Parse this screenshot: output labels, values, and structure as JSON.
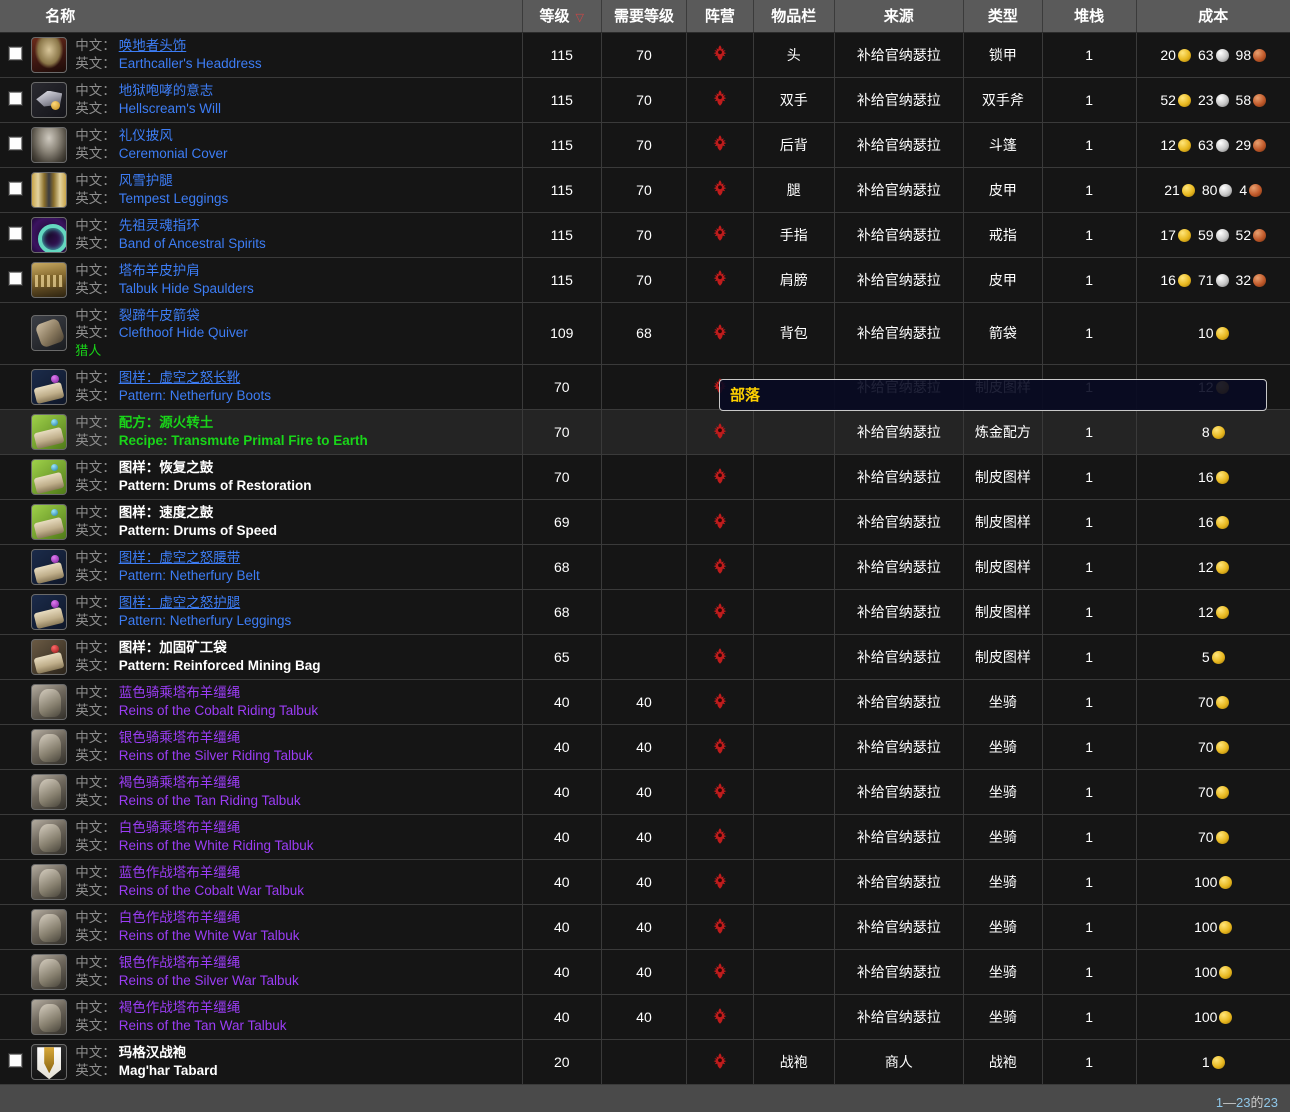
{
  "header": {
    "columns": [
      {
        "label": "",
        "key": "check"
      },
      {
        "label": "名称",
        "key": "name"
      },
      {
        "label": "等级",
        "key": "level",
        "sorted": true,
        "sort_arrow": "▽"
      },
      {
        "label": "需要等级",
        "key": "reqlevel"
      },
      {
        "label": "阵营",
        "key": "faction"
      },
      {
        "label": "物品栏",
        "key": "slot"
      },
      {
        "label": "来源",
        "key": "source"
      },
      {
        "label": "类型",
        "key": "type"
      },
      {
        "label": "堆栈",
        "key": "stack"
      },
      {
        "label": "成本",
        "key": "cost"
      }
    ]
  },
  "labels": {
    "cn": "中文：",
    "en": "英文："
  },
  "colors": {
    "quality_rare": "#3d7df5",
    "quality_epic": "#9b3df5",
    "quality_uncommon": "#19d519",
    "quality_common": "#ffffff",
    "gold": "#e8b820",
    "silver": "#c7c7c7",
    "copper": "#c0592a",
    "faction_horde": "#c01c1c",
    "header_bg": "#5a5a5a",
    "row_bg": "#151515",
    "row_hover_bg": "#242424"
  },
  "tooltip": {
    "visible": true,
    "text": "部落"
  },
  "footer": {
    "range_prefix": "1",
    "dash": "—",
    "range_end": "23",
    "of": "的",
    "total": "23",
    "text": "1—23的23"
  },
  "rows": [
    {
      "checkbox": true,
      "icon": "item-icon-headdress",
      "icon_class": "ic-head",
      "cn": "唤地者头饰",
      "en": "Earthcaller's Headdress",
      "quality": "rare",
      "underline": true,
      "level": "115",
      "reqlevel": "70",
      "faction": "horde",
      "slot": "头",
      "source": "补给官纳瑟拉",
      "type": "锁甲",
      "stack": "1",
      "cost": [
        {
          "amt": "20",
          "coin": "gold"
        },
        {
          "amt": "63",
          "coin": "silver"
        },
        {
          "amt": "98",
          "coin": "copper"
        }
      ]
    },
    {
      "checkbox": true,
      "icon": "item-icon-axe",
      "icon_class": "ic-axe",
      "cn": "地狱咆哮的意志",
      "en": "Hellscream's Will",
      "quality": "rare",
      "underline": false,
      "level": "115",
      "reqlevel": "70",
      "faction": "horde",
      "slot": "双手",
      "source": "补给官纳瑟拉",
      "type": "双手斧",
      "stack": "1",
      "cost": [
        {
          "amt": "52",
          "coin": "gold"
        },
        {
          "amt": "23",
          "coin": "silver"
        },
        {
          "amt": "58",
          "coin": "copper"
        }
      ]
    },
    {
      "checkbox": true,
      "icon": "item-icon-cloak",
      "icon_class": "ic-cloak",
      "cn": "礼仪披风",
      "en": "Ceremonial Cover",
      "quality": "rare",
      "underline": false,
      "level": "115",
      "reqlevel": "70",
      "faction": "horde",
      "slot": "后背",
      "source": "补给官纳瑟拉",
      "type": "斗篷",
      "stack": "1",
      "cost": [
        {
          "amt": "12",
          "coin": "gold"
        },
        {
          "amt": "63",
          "coin": "silver"
        },
        {
          "amt": "29",
          "coin": "copper"
        }
      ]
    },
    {
      "checkbox": true,
      "icon": "item-icon-leggings",
      "icon_class": "ic-legs",
      "cn": "风雪护腿",
      "en": "Tempest Leggings",
      "quality": "rare",
      "underline": false,
      "level": "115",
      "reqlevel": "70",
      "faction": "horde",
      "slot": "腿",
      "source": "补给官纳瑟拉",
      "type": "皮甲",
      "stack": "1",
      "cost": [
        {
          "amt": "21",
          "coin": "gold"
        },
        {
          "amt": "80",
          "coin": "silver"
        },
        {
          "amt": "4",
          "coin": "copper"
        }
      ]
    },
    {
      "checkbox": true,
      "icon": "item-icon-ring",
      "icon_class": "ic-ring",
      "cn": "先祖灵魂指环",
      "en": "Band of Ancestral Spirits",
      "quality": "rare",
      "underline": false,
      "level": "115",
      "reqlevel": "70",
      "faction": "horde",
      "slot": "手指",
      "source": "补给官纳瑟拉",
      "type": "戒指",
      "stack": "1",
      "cost": [
        {
          "amt": "17",
          "coin": "gold"
        },
        {
          "amt": "59",
          "coin": "silver"
        },
        {
          "amt": "52",
          "coin": "copper"
        }
      ]
    },
    {
      "checkbox": true,
      "icon": "item-icon-spaulders",
      "icon_class": "ic-shoulder",
      "cn": "塔布羊皮护肩",
      "en": "Talbuk Hide Spaulders",
      "quality": "rare",
      "underline": false,
      "level": "115",
      "reqlevel": "70",
      "faction": "horde",
      "slot": "肩膀",
      "source": "补给官纳瑟拉",
      "type": "皮甲",
      "stack": "1",
      "cost": [
        {
          "amt": "16",
          "coin": "gold"
        },
        {
          "amt": "71",
          "coin": "silver"
        },
        {
          "amt": "32",
          "coin": "copper"
        }
      ]
    },
    {
      "checkbox": false,
      "icon": "item-icon-quiver",
      "icon_class": "ic-quiver",
      "cn": "裂蹄牛皮箭袋",
      "en": "Clefthoof Hide Quiver",
      "quality": "rare",
      "underline": false,
      "level": "109",
      "reqlevel": "68",
      "faction": "horde",
      "slot": "背包",
      "source": "补给官纳瑟拉",
      "type": "箭袋",
      "stack": "1",
      "cost": [
        {
          "amt": "10",
          "coin": "gold"
        }
      ],
      "subclass": "猎人"
    },
    {
      "checkbox": false,
      "icon": "item-icon-pattern-blue",
      "icon_class": "ic-pat-b",
      "cn": "图样：虚空之怒长靴",
      "en": "Pattern: Netherfury Boots",
      "quality": "rare",
      "underline": true,
      "level": "70",
      "reqlevel": "",
      "faction": "horde",
      "slot": "",
      "source": "补给官纳瑟拉",
      "type": "制皮图样",
      "stack": "1",
      "cost": [
        {
          "amt": "12",
          "coin": "gold"
        }
      ]
    },
    {
      "checkbox": false,
      "icon": "item-icon-recipe-green",
      "icon_class": "ic-pat-g",
      "cn": "配方：源火转土",
      "en": "Recipe: Transmute Primal Fire to Earth",
      "quality": "uncommon",
      "underline": false,
      "level": "70",
      "reqlevel": "",
      "faction": "horde",
      "slot": "",
      "source": "补给官纳瑟拉",
      "type": "炼金配方",
      "stack": "1",
      "cost": [
        {
          "amt": "8",
          "coin": "gold"
        }
      ],
      "hover": true
    },
    {
      "checkbox": false,
      "icon": "item-icon-pattern-white",
      "icon_class": "ic-pat-g",
      "cn": "图样：恢复之鼓",
      "en": "Pattern: Drums of Restoration",
      "quality": "common",
      "underline": false,
      "level": "70",
      "reqlevel": "",
      "faction": "horde",
      "slot": "",
      "source": "补给官纳瑟拉",
      "type": "制皮图样",
      "stack": "1",
      "cost": [
        {
          "amt": "16",
          "coin": "gold"
        }
      ]
    },
    {
      "checkbox": false,
      "icon": "item-icon-pattern-white",
      "icon_class": "ic-pat-g",
      "cn": "图样：速度之鼓",
      "en": "Pattern: Drums of Speed",
      "quality": "common",
      "underline": false,
      "level": "69",
      "reqlevel": "",
      "faction": "horde",
      "slot": "",
      "source": "补给官纳瑟拉",
      "type": "制皮图样",
      "stack": "1",
      "cost": [
        {
          "amt": "16",
          "coin": "gold"
        }
      ]
    },
    {
      "checkbox": false,
      "icon": "item-icon-pattern-blue",
      "icon_class": "ic-pat-b",
      "cn": "图样：虚空之怒腰带",
      "en": "Pattern: Netherfury Belt",
      "quality": "rare",
      "underline": true,
      "level": "68",
      "reqlevel": "",
      "faction": "horde",
      "slot": "",
      "source": "补给官纳瑟拉",
      "type": "制皮图样",
      "stack": "1",
      "cost": [
        {
          "amt": "12",
          "coin": "gold"
        }
      ]
    },
    {
      "checkbox": false,
      "icon": "item-icon-pattern-blue",
      "icon_class": "ic-pat-b",
      "cn": "图样：虚空之怒护腿",
      "en": "Pattern: Netherfury Leggings",
      "quality": "rare",
      "underline": true,
      "level": "68",
      "reqlevel": "",
      "faction": "horde",
      "slot": "",
      "source": "补给官纳瑟拉",
      "type": "制皮图样",
      "stack": "1",
      "cost": [
        {
          "amt": "12",
          "coin": "gold"
        }
      ]
    },
    {
      "checkbox": false,
      "icon": "item-icon-pattern-red",
      "icon_class": "ic-pat-r",
      "cn": "图样：加固矿工袋",
      "en": "Pattern: Reinforced Mining Bag",
      "quality": "common",
      "underline": false,
      "level": "65",
      "reqlevel": "",
      "faction": "horde",
      "slot": "",
      "source": "补给官纳瑟拉",
      "type": "制皮图样",
      "stack": "1",
      "cost": [
        {
          "amt": "5",
          "coin": "gold"
        }
      ]
    },
    {
      "checkbox": false,
      "icon": "item-icon-talbuk",
      "icon_class": "ic-mount",
      "cn": "蓝色骑乘塔布羊缰绳",
      "en": "Reins of the Cobalt Riding Talbuk",
      "quality": "epic",
      "underline": false,
      "level": "40",
      "reqlevel": "40",
      "faction": "horde",
      "slot": "",
      "source": "补给官纳瑟拉",
      "type": "坐骑",
      "stack": "1",
      "cost": [
        {
          "amt": "70",
          "coin": "gold"
        }
      ]
    },
    {
      "checkbox": false,
      "icon": "item-icon-talbuk",
      "icon_class": "ic-mount",
      "cn": "银色骑乘塔布羊缰绳",
      "en": "Reins of the Silver Riding Talbuk",
      "quality": "epic",
      "underline": false,
      "level": "40",
      "reqlevel": "40",
      "faction": "horde",
      "slot": "",
      "source": "补给官纳瑟拉",
      "type": "坐骑",
      "stack": "1",
      "cost": [
        {
          "amt": "70",
          "coin": "gold"
        }
      ]
    },
    {
      "checkbox": false,
      "icon": "item-icon-talbuk",
      "icon_class": "ic-mount",
      "cn": "褐色骑乘塔布羊缰绳",
      "en": "Reins of the Tan Riding Talbuk",
      "quality": "epic",
      "underline": false,
      "level": "40",
      "reqlevel": "40",
      "faction": "horde",
      "slot": "",
      "source": "补给官纳瑟拉",
      "type": "坐骑",
      "stack": "1",
      "cost": [
        {
          "amt": "70",
          "coin": "gold"
        }
      ]
    },
    {
      "checkbox": false,
      "icon": "item-icon-talbuk",
      "icon_class": "ic-mount",
      "cn": "白色骑乘塔布羊缰绳",
      "en": "Reins of the White Riding Talbuk",
      "quality": "epic",
      "underline": false,
      "level": "40",
      "reqlevel": "40",
      "faction": "horde",
      "slot": "",
      "source": "补给官纳瑟拉",
      "type": "坐骑",
      "stack": "1",
      "cost": [
        {
          "amt": "70",
          "coin": "gold"
        }
      ]
    },
    {
      "checkbox": false,
      "icon": "item-icon-talbuk",
      "icon_class": "ic-mount",
      "cn": "蓝色作战塔布羊缰绳",
      "en": "Reins of the Cobalt War Talbuk",
      "quality": "epic",
      "underline": false,
      "level": "40",
      "reqlevel": "40",
      "faction": "horde",
      "slot": "",
      "source": "补给官纳瑟拉",
      "type": "坐骑",
      "stack": "1",
      "cost": [
        {
          "amt": "100",
          "coin": "gold"
        }
      ]
    },
    {
      "checkbox": false,
      "icon": "item-icon-talbuk",
      "icon_class": "ic-mount",
      "cn": "白色作战塔布羊缰绳",
      "en": "Reins of the White War Talbuk",
      "quality": "epic",
      "underline": false,
      "level": "40",
      "reqlevel": "40",
      "faction": "horde",
      "slot": "",
      "source": "补给官纳瑟拉",
      "type": "坐骑",
      "stack": "1",
      "cost": [
        {
          "amt": "100",
          "coin": "gold"
        }
      ]
    },
    {
      "checkbox": false,
      "icon": "item-icon-talbuk",
      "icon_class": "ic-mount",
      "cn": "银色作战塔布羊缰绳",
      "en": "Reins of the Silver War Talbuk",
      "quality": "epic",
      "underline": false,
      "level": "40",
      "reqlevel": "40",
      "faction": "horde",
      "slot": "",
      "source": "补给官纳瑟拉",
      "type": "坐骑",
      "stack": "1",
      "cost": [
        {
          "amt": "100",
          "coin": "gold"
        }
      ]
    },
    {
      "checkbox": false,
      "icon": "item-icon-talbuk",
      "icon_class": "ic-mount",
      "cn": "褐色作战塔布羊缰绳",
      "en": "Reins of the Tan War Talbuk",
      "quality": "epic",
      "underline": false,
      "level": "40",
      "reqlevel": "40",
      "faction": "horde",
      "slot": "",
      "source": "补给官纳瑟拉",
      "type": "坐骑",
      "stack": "1",
      "cost": [
        {
          "amt": "100",
          "coin": "gold"
        }
      ]
    },
    {
      "checkbox": true,
      "icon": "item-icon-tabard",
      "icon_class": "ic-tabard",
      "cn": "玛格汉战袍",
      "en": "Mag'har Tabard",
      "quality": "common",
      "underline": false,
      "level": "20",
      "reqlevel": "",
      "faction": "horde",
      "slot": "战袍",
      "source": "商人",
      "type": "战袍",
      "stack": "1",
      "cost": [
        {
          "amt": "1",
          "coin": "gold"
        }
      ]
    }
  ]
}
